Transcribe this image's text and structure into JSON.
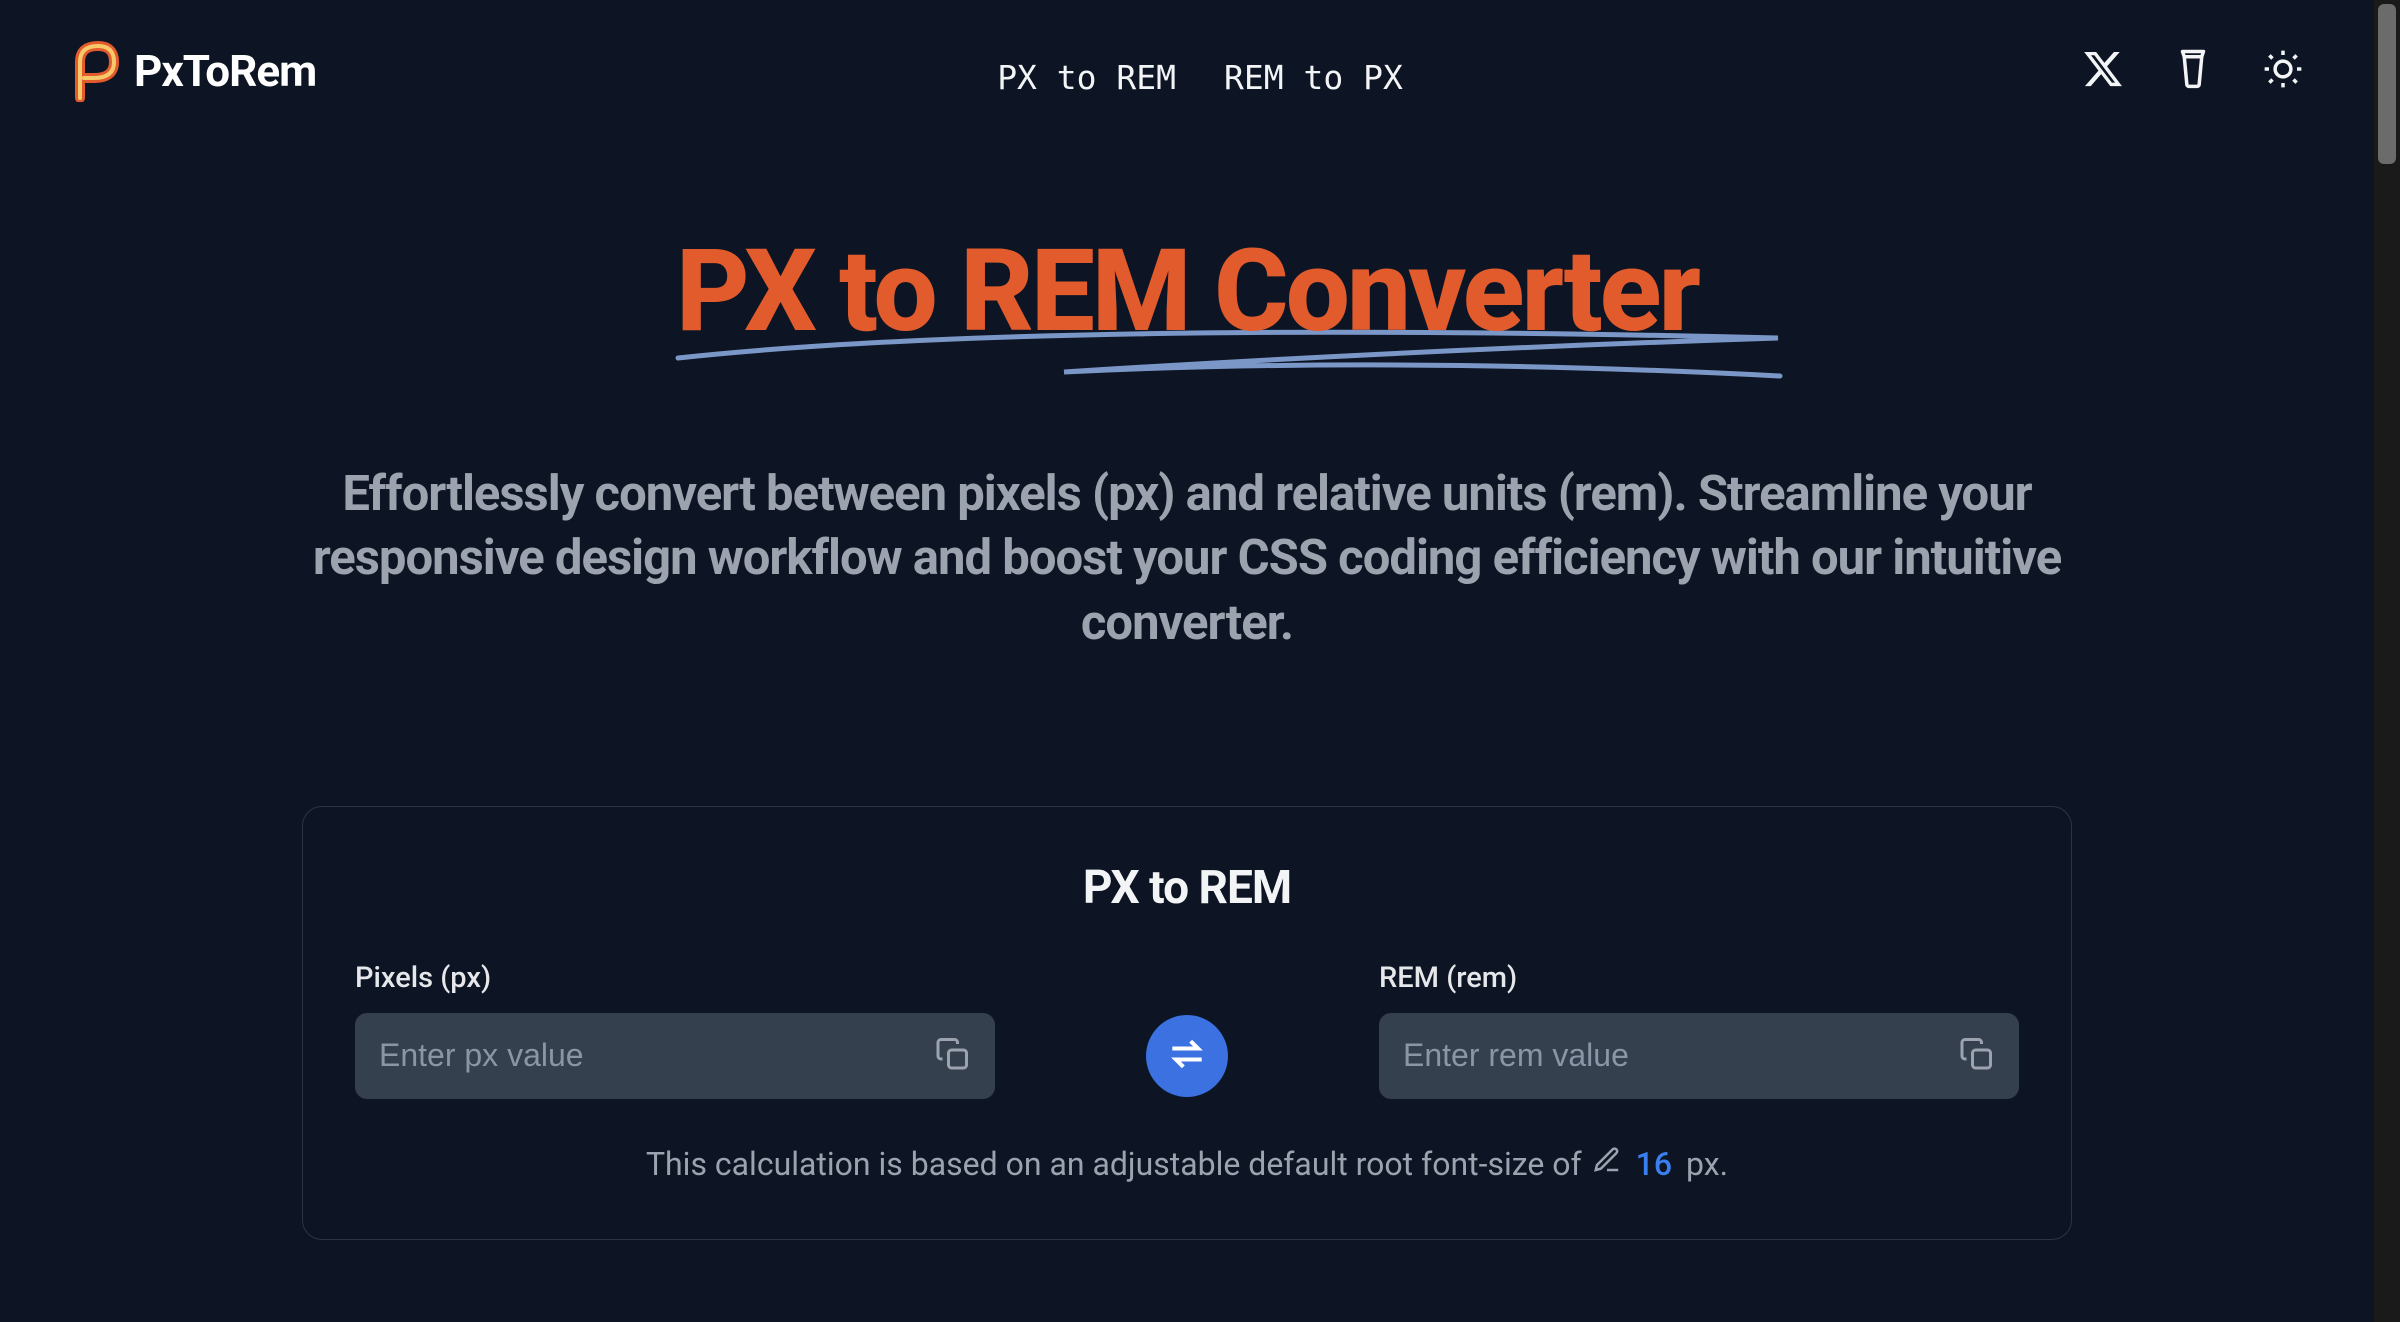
{
  "brand": {
    "name": "PxToRem"
  },
  "nav": {
    "link1": "PX to REM",
    "link2": "REM to PX"
  },
  "hero": {
    "title": "PX to REM Converter",
    "subtitle": "Effortlessly convert between pixels (px) and relative units (rem). Streamline your responsive design workflow and boost your CSS coding efficiency with our intuitive converter."
  },
  "converter": {
    "title": "PX to REM",
    "px_label": "Pixels (px)",
    "px_placeholder": "Enter px value",
    "rem_label": "REM (rem)",
    "rem_placeholder": "Enter rem value",
    "note_prefix": "This calculation is based on an adjustable default root font-size of",
    "base_value": "16",
    "note_suffix": "px."
  },
  "colors": {
    "background": "#0d1524",
    "accent": "#e25b2d",
    "link_accent": "#3a7ff0",
    "card_border": "#2a3447",
    "input_bg": "#35404f",
    "muted_text": "#9ca3af"
  }
}
